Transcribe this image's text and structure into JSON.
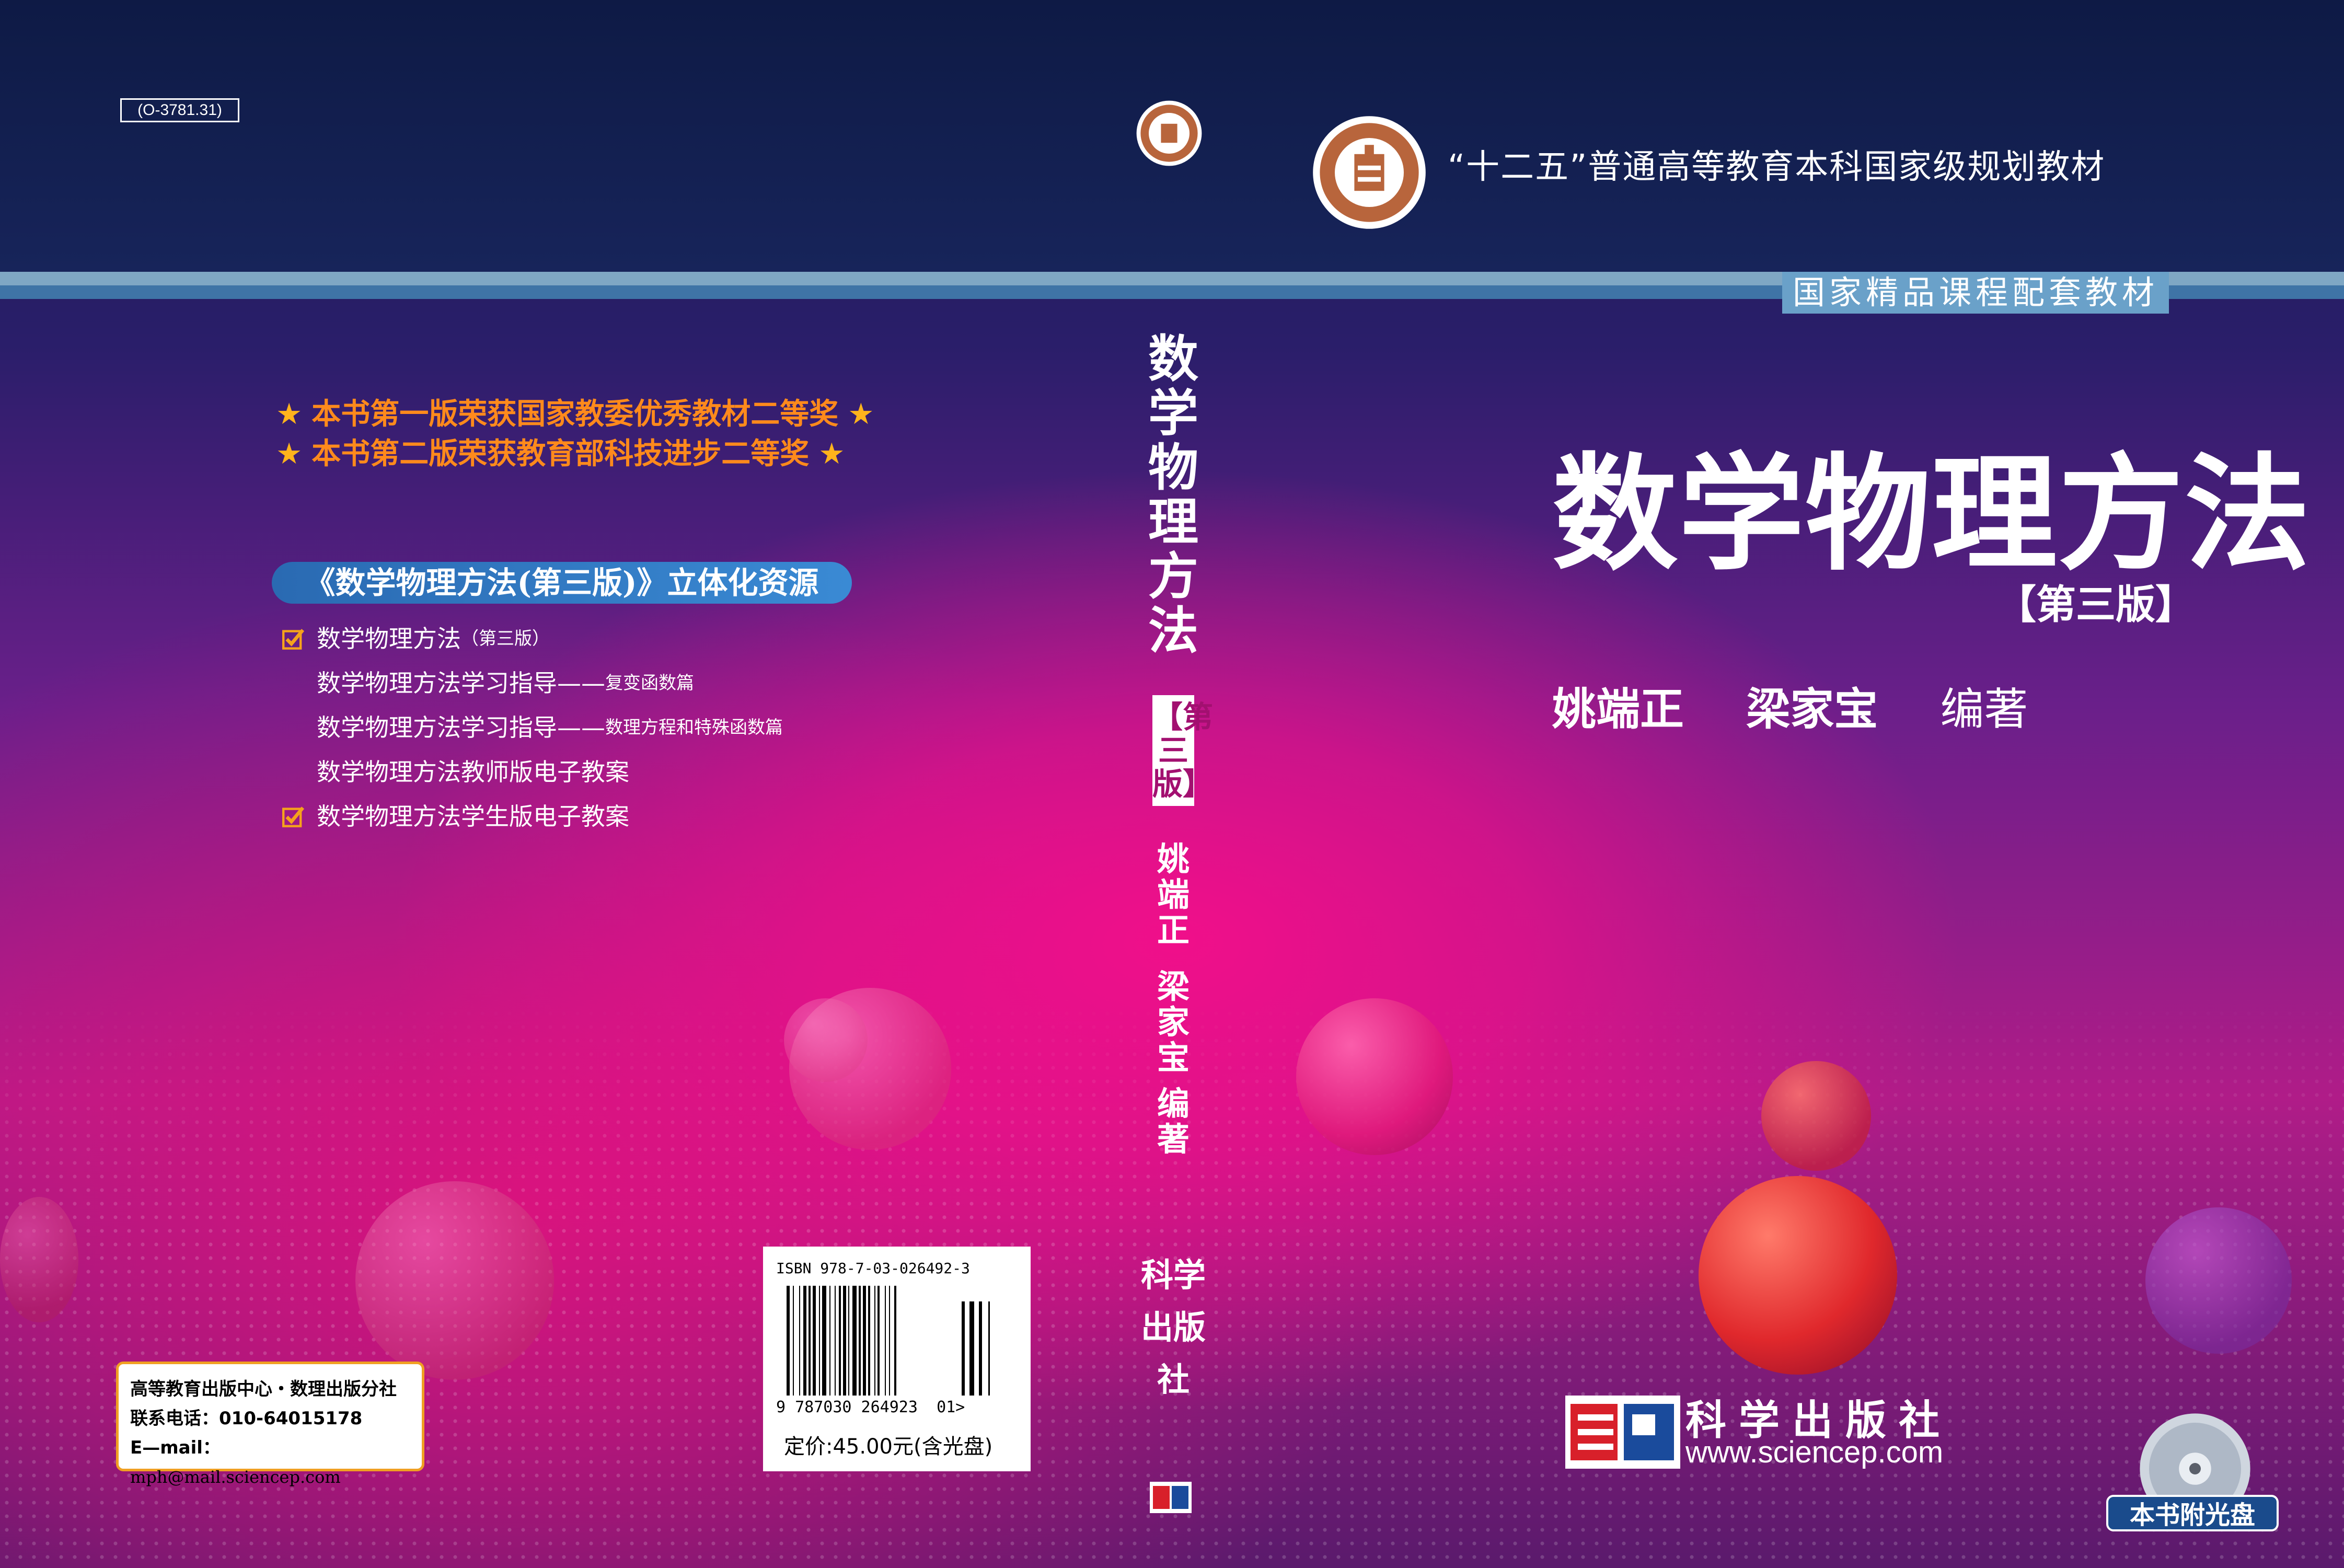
{
  "catalog_code": "(O-3781.31)",
  "series": "“十二五”普通高等教育本科国家级规划教材",
  "sub_series": "国家精品课程配套教材",
  "title": "数学物理方法",
  "edition": "【第三版】",
  "authors": [
    "姚端正",
    "梁家宝"
  ],
  "author_role": "编著",
  "awards": [
    "本书第一版荣获国家教委优秀教材二等奖",
    "本书第二版荣获教育部科技进步二等奖"
  ],
  "resources": {
    "heading": "《数学物理方法(第三版)》立体化资源",
    "items": [
      {
        "main": "数学物理方法",
        "suffix": "（第三版）",
        "checked": true
      },
      {
        "main": "数学物理方法学习指导——",
        "suffix": "复变函数篇",
        "checked": false
      },
      {
        "main": "数学物理方法学习指导——",
        "suffix": "数理方程和特殊函数篇",
        "checked": false
      },
      {
        "main": "数学物理方法教师版电子教案",
        "suffix": "",
        "checked": false
      },
      {
        "main": "数学物理方法学生版电子教案",
        "suffix": "",
        "checked": true
      }
    ]
  },
  "spine": {
    "title": "数学物理方法",
    "edition": "【第三版】",
    "author1": "姚端正",
    "author2": "梁家宝",
    "role": "编著",
    "publisher": "科学出版社"
  },
  "isbn": "ISBN 978-7-03-026492-3",
  "barcode_digits": "9 787030 264923",
  "barcode_addon": "01>",
  "price": "定价:45.00元(含光盘)",
  "contact": {
    "line1": "高等教育出版中心・数理出版分社",
    "line2": "联系电话：010-64015178",
    "line3_label": "E—mail：",
    "line3_value": "mph@mail.sciencep.com"
  },
  "publisher": {
    "name": "科学出版社",
    "url": "www.sciencep.com"
  },
  "cd_label": "本书附光盘",
  "colors": {
    "top_band": "#0e1a45",
    "accent_orange": "#ff8a1c",
    "resource_blue": "#2a6ab2",
    "magenta": "#f00f8a"
  }
}
